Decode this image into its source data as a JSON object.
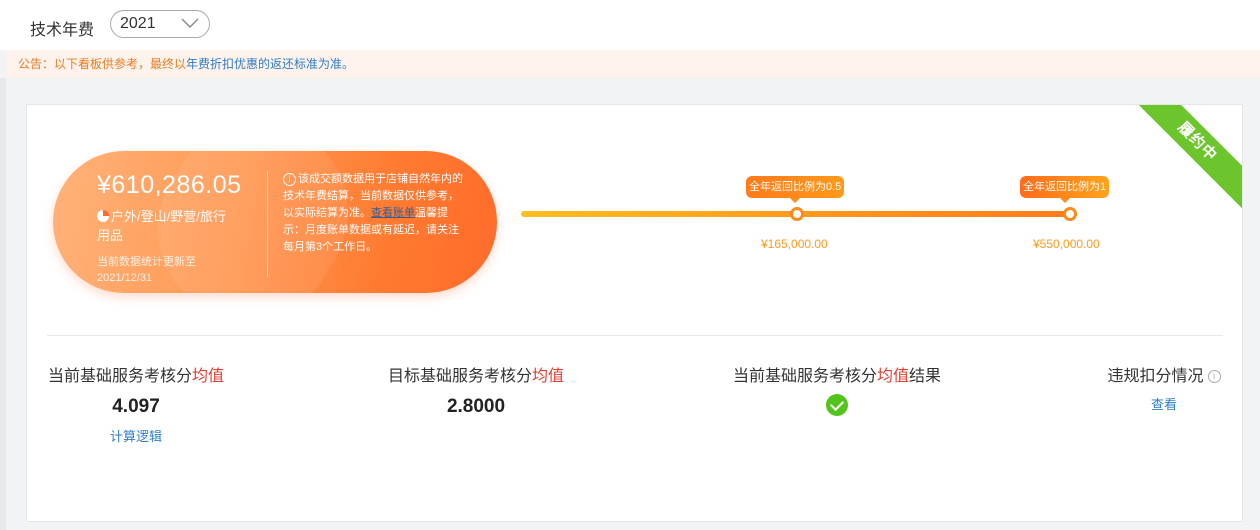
{
  "header": {
    "title": "技术年费",
    "year_select": {
      "value": "2021"
    }
  },
  "notice": {
    "prefix": "公告：以下看板供参考，最终以",
    "link": "年费折扣优惠的返还标准为准。"
  },
  "status_ribbon": "履约中",
  "summary": {
    "amount": "¥610,286.05",
    "category": "户外/登山/野营/旅行用品",
    "update_line1": "当前数据统计更新至",
    "update_line2": "2021/12/31",
    "info_text": "该成交额数据用于店铺自然年内的技术年费结算，当前数据仅供参考，以实际结算为准。",
    "bill_link": "查看账单",
    "info_tip": "温馨提示：月度账单数据或有延迟，请关注每月第3个工作日。"
  },
  "progress": {
    "bubble1": "全年返回比例为0.5",
    "bubble2": "全年返回比例为1",
    "threshold1": "¥165,000.00",
    "threshold2": "¥550,000.00"
  },
  "metrics": {
    "current_avg": {
      "label_prefix": "当前基础服务考核分",
      "label_hl": "均值",
      "value": "4.097",
      "link": "计算逻辑"
    },
    "target_avg": {
      "label_prefix": "目标基础服务考核分",
      "label_hl": "均值",
      "value": "2.8000"
    },
    "avg_result": {
      "label_prefix": "当前基础服务考核分",
      "label_hl": "均值",
      "label_suffix": "结果",
      "status": "pass"
    },
    "violation": {
      "label": "违规扣分情况",
      "link": "查看"
    }
  },
  "colors": {
    "accent_orange": "#ff7a30",
    "link_blue": "#2f7ec6",
    "highlight_red": "#e23d2e",
    "ok_green": "#52c41a",
    "ribbon_green": "#6cc52c"
  }
}
